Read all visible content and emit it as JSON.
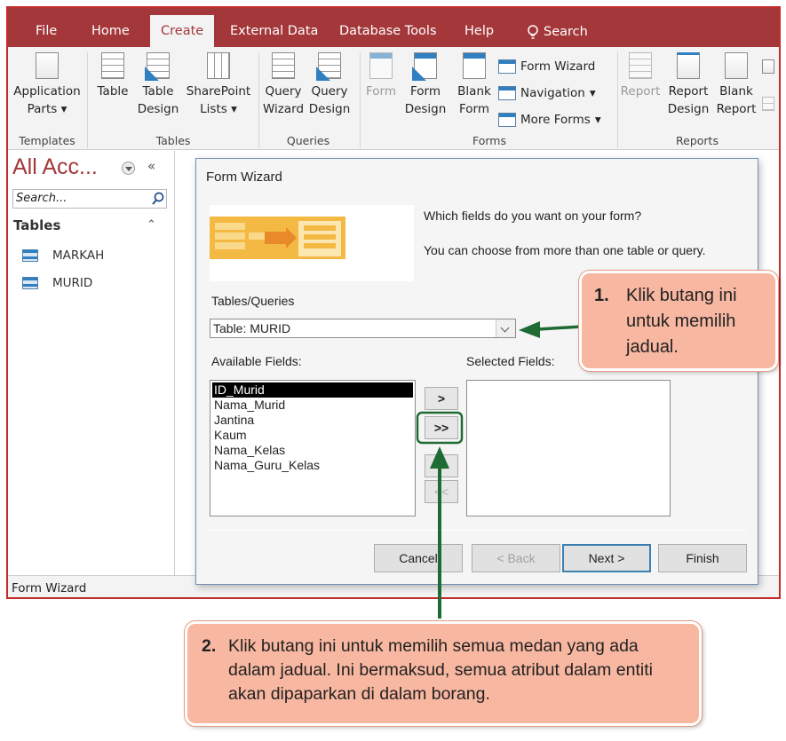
{
  "tabs": [
    {
      "label": "File",
      "active": false
    },
    {
      "label": "Home",
      "active": false
    },
    {
      "label": "Create",
      "active": true
    },
    {
      "label": "External Data",
      "active": false
    },
    {
      "label": "Database Tools",
      "active": false
    },
    {
      "label": "Help",
      "active": false
    }
  ],
  "tell_me": {
    "label": "Search",
    "icon": "lightbulb-icon"
  },
  "ribbon": {
    "templates": {
      "group": "Templates",
      "application_parts": "Application",
      "application_parts_2": "Parts"
    },
    "tables": {
      "group": "Tables",
      "table": "Table",
      "table_design_1": "Table",
      "table_design_2": "Design",
      "sharepoint_1": "SharePoint",
      "sharepoint_2": "Lists"
    },
    "queries": {
      "group": "Queries",
      "query_wizard_1": "Query",
      "query_wizard_2": "Wizard",
      "query_design_1": "Query",
      "query_design_2": "Design"
    },
    "forms": {
      "group": "Forms",
      "form": "Form",
      "form_design_1": "Form",
      "form_design_2": "Design",
      "blank_form_1": "Blank",
      "blank_form_2": "Form",
      "form_wizard": "Form Wizard",
      "navigation": "Navigation",
      "more_forms": "More Forms"
    },
    "reports": {
      "group": "Reports",
      "report": "Report",
      "report_design_1": "Report",
      "report_design_2": "Design",
      "blank_report_1": "Blank",
      "blank_report_2": "Report"
    },
    "dropdown_caret": "▾"
  },
  "nav_pane": {
    "title": "All Acc...",
    "collapse_glyph": "«",
    "search_placeholder": "Search...",
    "section": "Tables",
    "section_glyph": "⌃",
    "items": [
      {
        "label": "MARKAH",
        "icon": "table-icon"
      },
      {
        "label": "MURID",
        "icon": "table-icon"
      }
    ]
  },
  "status_bar": {
    "text": "Form Wizard"
  },
  "dialog": {
    "title": "Form Wizard",
    "prompt_1": "Which fields do you want on your form?",
    "prompt_2": "You can choose from more than one table or query.",
    "tables_queries_label": "Tables/Queries",
    "tables_queries_value": "Table: MURID",
    "available_label": "Available Fields:",
    "selected_label": "Selected Fields:",
    "available_fields": [
      "ID_Murid",
      "Nama_Murid",
      "Jantina",
      "Kaum",
      "Nama_Kelas",
      "Nama_Guru_Kelas"
    ],
    "selected_field": "ID_Murid",
    "selected_fields": [],
    "move_buttons": {
      "add_one": ">",
      "add_all": ">>",
      "remove_one": "<",
      "remove_all": "<<"
    },
    "buttons": {
      "cancel": "Cancel",
      "back": "< Back",
      "next": "Next >",
      "finish": "Finish"
    }
  },
  "callouts": {
    "one": {
      "number": "1.",
      "text": "Klik butang ini untuk memilih jadual."
    },
    "two": {
      "number": "2.",
      "text": "Klik butang ini untuk memilih semua medan yang ada dalam jadual. Ini bermaksud, semua atribut dalam entiti akan dipaparkan di dalam borang."
    }
  },
  "colors": {
    "access_red": "#a4373a",
    "window_border": "#c42b2b",
    "arrow_green": "#1e6b34",
    "callout_fill": "#f8b7a0",
    "selected_row": "#000000"
  }
}
